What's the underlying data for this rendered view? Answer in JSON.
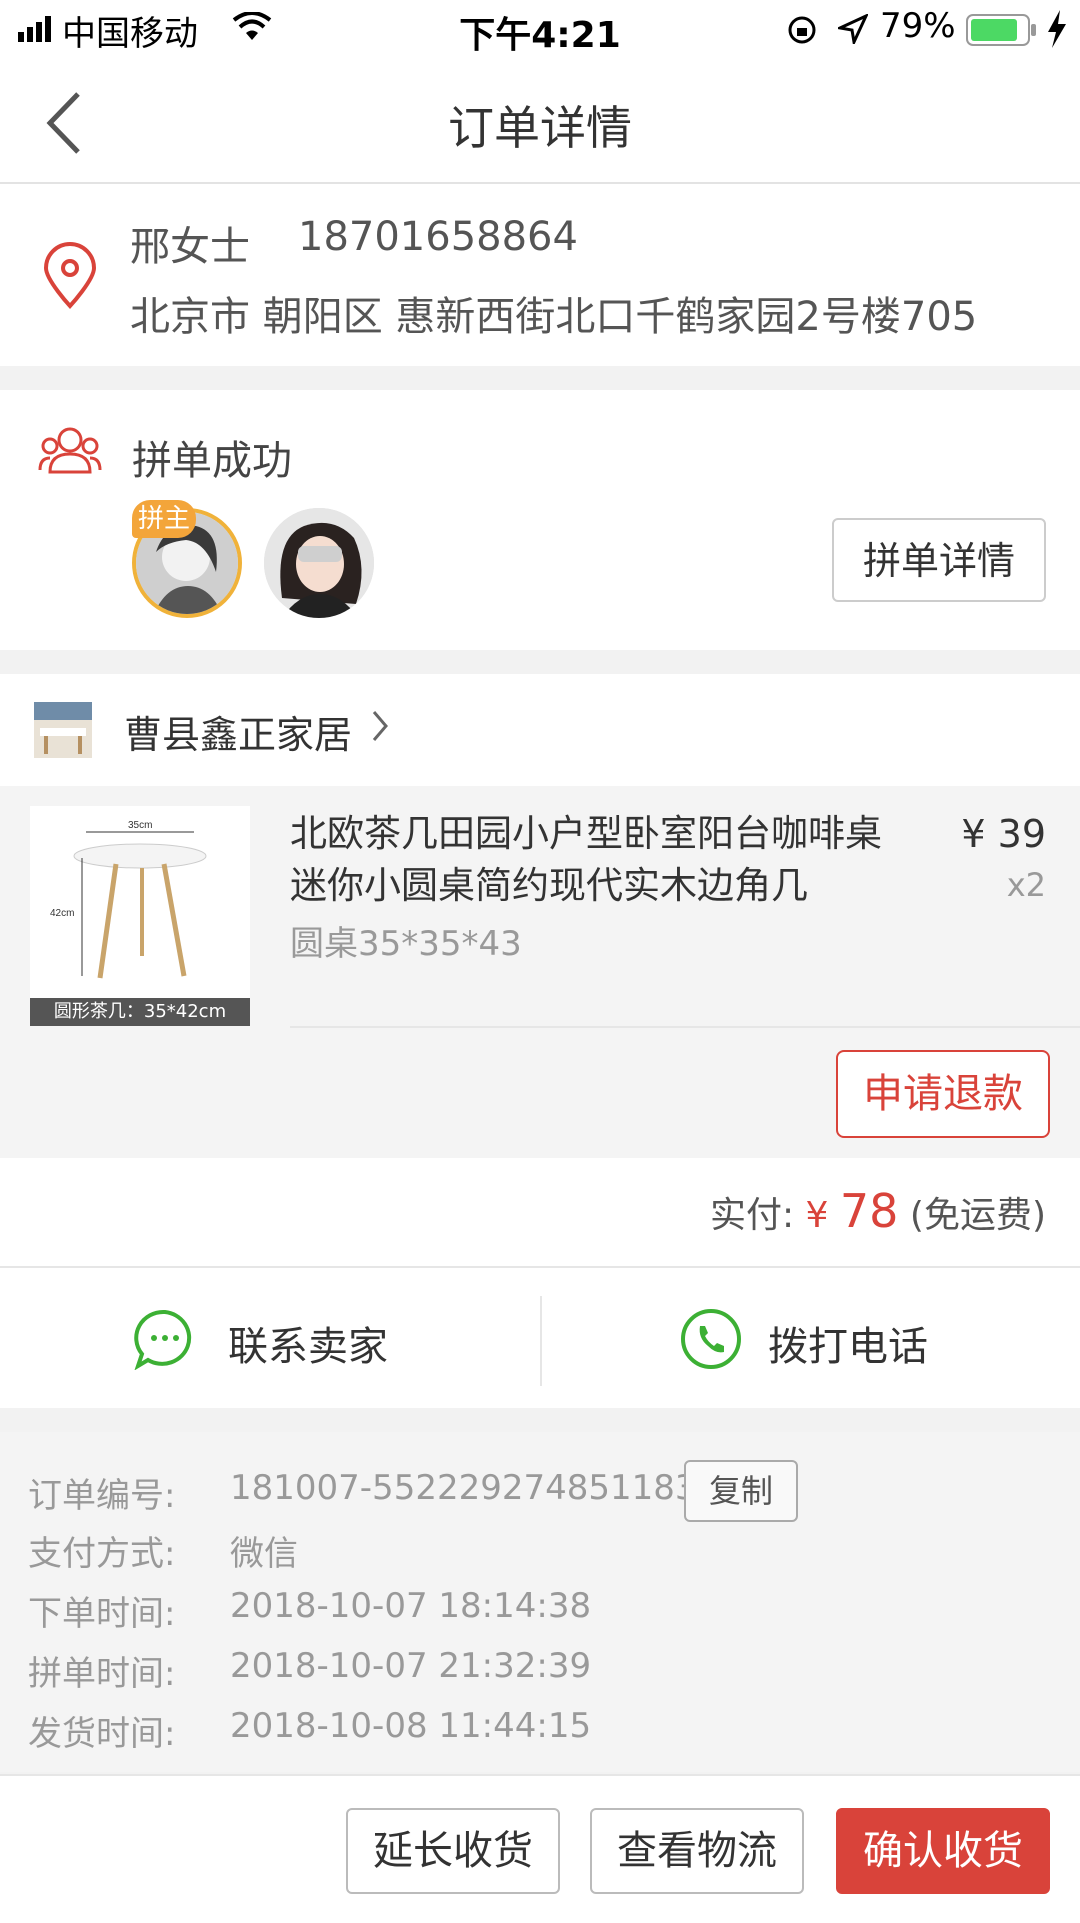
{
  "status_bar": {
    "carrier": "中国移动",
    "time": "下午4:21",
    "battery": "79%"
  },
  "nav": {
    "title": "订单详情"
  },
  "address": {
    "name": "邢女士",
    "phone": "18701658864",
    "line": "北京市 朝阳区 惠新西街北口千鹤家园2号楼705"
  },
  "group": {
    "title": "拼单成功",
    "host_badge": "拼主",
    "details_button": "拼单详情"
  },
  "shop": {
    "name": "曹县鑫正家居"
  },
  "product": {
    "title": "北欧茶几田园小户型卧室阳台咖啡桌迷你小圆桌简约现代实木边角几",
    "price": "¥ 39",
    "qty": "x2",
    "spec": "圆桌35*35*43",
    "image_caption": "圆形茶几：35*42cm",
    "image_width_label": "35cm",
    "image_height_label": "42cm",
    "refund_button": "申请退款"
  },
  "payment": {
    "label": "实付:",
    "currency": "¥",
    "amount": "78",
    "note": "(免运费)"
  },
  "contact": {
    "seller_label": "联系卖家",
    "call_label": "拨打电话"
  },
  "order_info": {
    "rows": [
      {
        "label": "订单编号:",
        "value": "181007-552229274851183"
      },
      {
        "label": "支付方式:",
        "value": "微信"
      },
      {
        "label": "下单时间:",
        "value": "2018-10-07 18:14:38"
      },
      {
        "label": "拼单时间:",
        "value": "2018-10-07 21:32:39"
      },
      {
        "label": "发货时间:",
        "value": "2018-10-08 11:44:15"
      }
    ],
    "copy_button": "复制"
  },
  "bottom_bar": {
    "extend": "延长收货",
    "logistics": "查看物流",
    "confirm": "确认收货"
  },
  "colors": {
    "accent_red": "#d9433a",
    "wechat_green": "#3cb034",
    "host_orange": "#f3a53a"
  }
}
